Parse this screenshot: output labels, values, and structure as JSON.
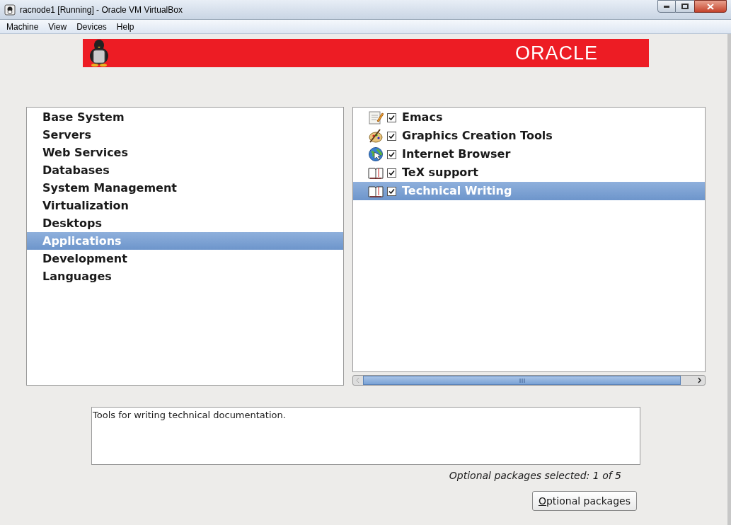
{
  "window": {
    "title": "racnode1 [Running] - Oracle VM VirtualBox"
  },
  "menu": [
    "Machine",
    "View",
    "Devices",
    "Help"
  ],
  "banner": {
    "logo": "ORACLE"
  },
  "groups": [
    {
      "label": "Base System",
      "selected": false
    },
    {
      "label": "Servers",
      "selected": false
    },
    {
      "label": "Web Services",
      "selected": false
    },
    {
      "label": "Databases",
      "selected": false
    },
    {
      "label": "System Management",
      "selected": false
    },
    {
      "label": "Virtualization",
      "selected": false
    },
    {
      "label": "Desktops",
      "selected": false
    },
    {
      "label": "Applications",
      "selected": true
    },
    {
      "label": "Development",
      "selected": false
    },
    {
      "label": "Languages",
      "selected": false
    }
  ],
  "packages": [
    {
      "label": "Emacs",
      "kind": "editor",
      "checked": true,
      "selected": false
    },
    {
      "label": "Graphics Creation Tools",
      "kind": "graphics",
      "checked": true,
      "selected": false
    },
    {
      "label": "Internet Browser",
      "kind": "browser",
      "checked": true,
      "selected": false
    },
    {
      "label": "TeX support",
      "kind": "book",
      "checked": true,
      "selected": false
    },
    {
      "label": "Technical Writing",
      "kind": "book",
      "checked": true,
      "selected": true
    }
  ],
  "description": "Tools for writing technical documentation.",
  "status": "Optional packages selected: 1 of 5",
  "button": {
    "label": "Optional packages"
  }
}
